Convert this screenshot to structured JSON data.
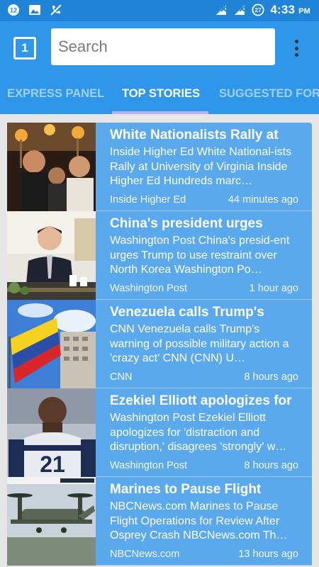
{
  "status_bar": {
    "notification_badge": "12",
    "battery_percent": "27",
    "time": "4:33",
    "ampm": "PM"
  },
  "app_bar": {
    "tab_count": "1",
    "search": {
      "placeholder": "Search",
      "value": ""
    }
  },
  "tabs": [
    {
      "label": "EXPRESS PANEL",
      "active": false
    },
    {
      "label": "TOP STORIES",
      "active": true
    },
    {
      "label": "SUGGESTED FOR YOU",
      "active": false
    }
  ],
  "stories": [
    {
      "headline": "White Nationalists Rally at",
      "summary": "Inside Higher Ed White National-ists Rally at University of Virginia Inside Higher Ed Hundreds marc…",
      "source": "Inside Higher Ed",
      "time": "44 minutes ago",
      "thumbnail_icon": "rally-photo"
    },
    {
      "headline": "China's president urges",
      "summary": "Washington Post China's presid-ent urges Trump to use restraint over North Korea Washington Po…",
      "source": "Washington Post",
      "time": "1 hour ago",
      "thumbnail_icon": "president-photo"
    },
    {
      "headline": "Venezuela calls Trump's",
      "summary": "CNN Venezuela calls Trump's warning of possible military action a 'crazy act' CNN (CNN) U…",
      "source": "CNN",
      "time": "8 hours ago",
      "thumbnail_icon": "venezuela-flag-photo"
    },
    {
      "headline": "Ezekiel Elliott apologizes for",
      "summary": "Washington Post Ezekiel Elliott apologizes for 'distraction and disruption,' disagrees 'strongly' w…",
      "source": "Washington Post",
      "time": "8 hours ago",
      "thumbnail_icon": "football-player-photo"
    },
    {
      "headline": "Marines to Pause Flight",
      "summary": "NBCNews.com Marines to Pause Flight Operations for Review After Osprey Crash NBCNews.com Th…",
      "source": "NBCNews.com",
      "time": "13 hours ago",
      "thumbnail_icon": "osprey-aircraft-photo"
    }
  ],
  "colors": {
    "status_bar": "#1f84d8",
    "app_bar": "#2f97ea",
    "card": "#5aa9ec",
    "tab_indicator": "#b8b4ec"
  }
}
